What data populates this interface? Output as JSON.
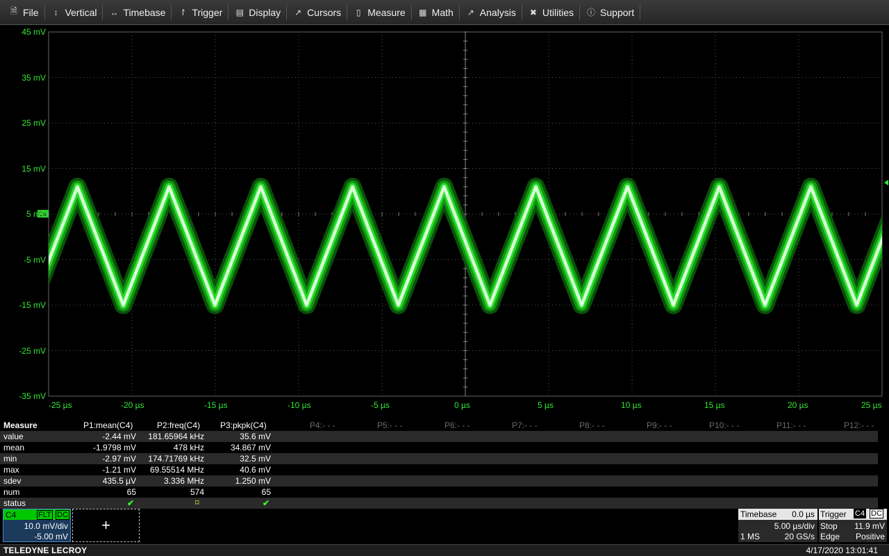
{
  "menu": [
    {
      "label": "File",
      "icon": "file-icon"
    },
    {
      "label": "Vertical",
      "icon": "vertical-arrows-icon"
    },
    {
      "label": "Timebase",
      "icon": "horizontal-arrows-icon"
    },
    {
      "label": "Trigger",
      "icon": "trigger-icon"
    },
    {
      "label": "Display",
      "icon": "display-icon"
    },
    {
      "label": "Cursors",
      "icon": "cursor-icon"
    },
    {
      "label": "Measure",
      "icon": "measure-icon"
    },
    {
      "label": "Math",
      "icon": "calculator-icon"
    },
    {
      "label": "Analysis",
      "icon": "analysis-chart-icon"
    },
    {
      "label": "Utilities",
      "icon": "tools-icon"
    },
    {
      "label": "Support",
      "icon": "info-icon"
    }
  ],
  "chart_data": {
    "type": "line",
    "title": "",
    "xlabel": "",
    "ylabel": "",
    "x_ticks": [
      "-25 µs",
      "-20 µs",
      "-15 µs",
      "-10 µs",
      "-5 µs",
      "0 µs",
      "5 µs",
      "10 µs",
      "15 µs",
      "20 µs",
      "25 µs"
    ],
    "y_ticks": [
      "45 mV",
      "35 mV",
      "25 mV",
      "15 mV",
      "5 mV",
      "-5 mV",
      "-15 mV",
      "-25 mV",
      "-35 mV"
    ],
    "xlim": [
      -25,
      25
    ],
    "ylim": [
      -35,
      45
    ],
    "x_unit": "µs",
    "y_unit": "mV",
    "grid": true,
    "series": [
      {
        "color": "#33ff33",
        "waveform": "triangle",
        "x": [
          -26.02,
          -23.27,
          -20.52,
          -17.77,
          -15.02,
          -12.27,
          -9.52,
          -6.77,
          -4.02,
          -1.27,
          1.48,
          4.23,
          6.98,
          9.73,
          12.48,
          15.23,
          17.98,
          20.73,
          23.48,
          26.23
        ],
        "y": [
          -15,
          11,
          -15,
          11,
          -15,
          11,
          -15,
          11,
          -15,
          11,
          -15,
          11,
          -15,
          11,
          -15,
          11,
          -15,
          11,
          -15,
          11
        ]
      }
    ],
    "channel_label": "C4"
  },
  "measure": {
    "title": "Measure",
    "headers": [
      "P1:mean(C4)",
      "P2:freq(C4)",
      "P3:pkpk(C4)"
    ],
    "inactive": [
      "P4:- - -",
      "P5:- - -",
      "P6:- - -",
      "P7:- - -",
      "P8:- - -",
      "P9:- - -",
      "P10:- - -",
      "P11:- - -",
      "P12:- - -"
    ],
    "rows": [
      {
        "label": "value",
        "p1": "-2.44 mV",
        "p2": "181.65964 kHz",
        "p3": "35.6 mV"
      },
      {
        "label": "mean",
        "p1": "-1.9798 mV",
        "p2": "478 kHz",
        "p3": "34.867 mV"
      },
      {
        "label": "min",
        "p1": "-2.97 mV",
        "p2": "174.71769 kHz",
        "p3": "32.5 mV"
      },
      {
        "label": "max",
        "p1": "-1.21 mV",
        "p2": "69.55514 MHz",
        "p3": "40.6 mV"
      },
      {
        "label": "sdev",
        "p1": "435.5 µV",
        "p2": "3.336 MHz",
        "p3": "1.250 mV"
      },
      {
        "label": "num",
        "p1": "65",
        "p2": "574",
        "p3": "65"
      }
    ],
    "status_label": "status"
  },
  "channel": {
    "name": "C4",
    "tag1": "FLT",
    "tag2": "DC",
    "vdiv": "10.0 mV/div",
    "offset": "-5.00 mV"
  },
  "timebase": {
    "title": "Timebase",
    "delay": "0.0 µs",
    "tdiv": "5.00 µs/div",
    "points": "1 MS",
    "rate": "20 GS/s"
  },
  "trigger": {
    "title": "Trigger",
    "source": "C4",
    "coupling": "DC",
    "level": "11.9 mV",
    "mode": "Stop",
    "type": "Edge",
    "slope": "Positive"
  },
  "status": {
    "brand": "TELEDYNE LECROY",
    "datetime": "4/17/2020 13:01:41"
  },
  "colors": {
    "trace": "#33ff33",
    "axis_labels": "#33e833",
    "grid": "#5a5a5a"
  }
}
